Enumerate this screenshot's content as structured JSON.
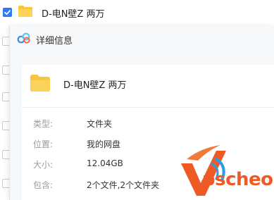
{
  "file_list": {
    "selected_row": {
      "name": "D-电N壁Z 两万",
      "checked": true
    }
  },
  "detail_panel": {
    "title": "详细信息",
    "logo_icon": "baidu-netdisk-cloud-icon",
    "item": {
      "name": "D-电N壁Z 两万",
      "icon": "folder-icon"
    },
    "rows": [
      {
        "label": "类型:",
        "value": "文件夹"
      },
      {
        "label": "位置:",
        "value": "我的网盘"
      },
      {
        "label": "大小:",
        "value": "12.04GB"
      },
      {
        "label": "包含:",
        "value": "2个文件,2个文件夹"
      }
    ]
  },
  "watermark": {
    "text": "pscheo"
  },
  "colors": {
    "accent": "#2f7bf6",
    "folder": "#f9c53d",
    "watermark": "#ef5a24"
  }
}
